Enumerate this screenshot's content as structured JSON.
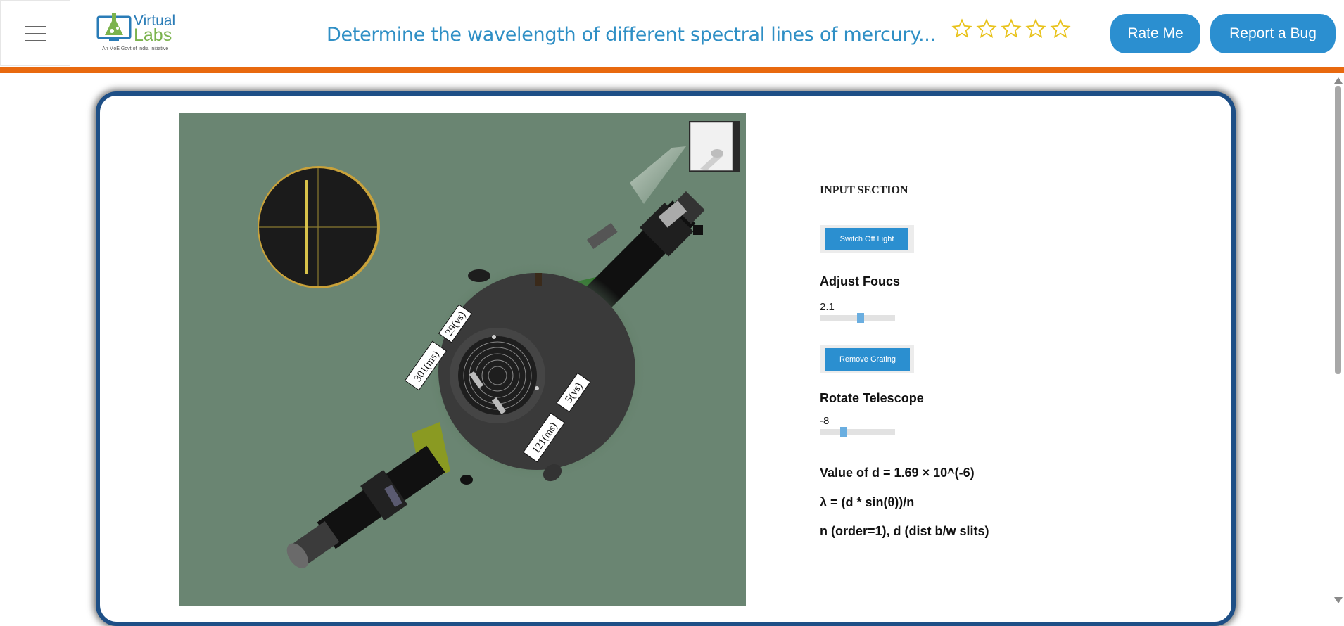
{
  "header": {
    "logo": {
      "word1": "Virtual",
      "word2": "Labs",
      "tagline": "An MoE Govt of India Initiative"
    },
    "title": "Determine the wavelength of different spectral lines of mercury...",
    "rating": {
      "stars": 5,
      "filled": 0
    },
    "rate_label": "Rate Me",
    "bug_label": "Report a Bug"
  },
  "simulation": {
    "scale_labels": [
      "29(vs)",
      "301(ms)",
      "5(vs)",
      "121(ms)"
    ]
  },
  "input_section": {
    "title": "INPUT SECTION",
    "light_button": "Switch Off Light",
    "focus_label": "Adjust Foucs",
    "focus_value": "2.1",
    "focus_level": 0.55,
    "grating_button": "Remove Grating",
    "rotate_label": "Rotate Telescope",
    "rotate_value": "-8",
    "rotate_level": 0.3,
    "d_text": "Value of d = 1.69 × 10^(-6)",
    "formula_text": "λ = (d * sin(θ))/n",
    "legend_text": "n (order=1), d (dist b/w slits)"
  },
  "colors": {
    "accent": "#2b8fd0",
    "orange_bar": "#e8690f",
    "card_border": "#1e4f86",
    "sim_bg": "#6a8572",
    "title": "#2f8fc5",
    "star": "#e8c21a"
  }
}
